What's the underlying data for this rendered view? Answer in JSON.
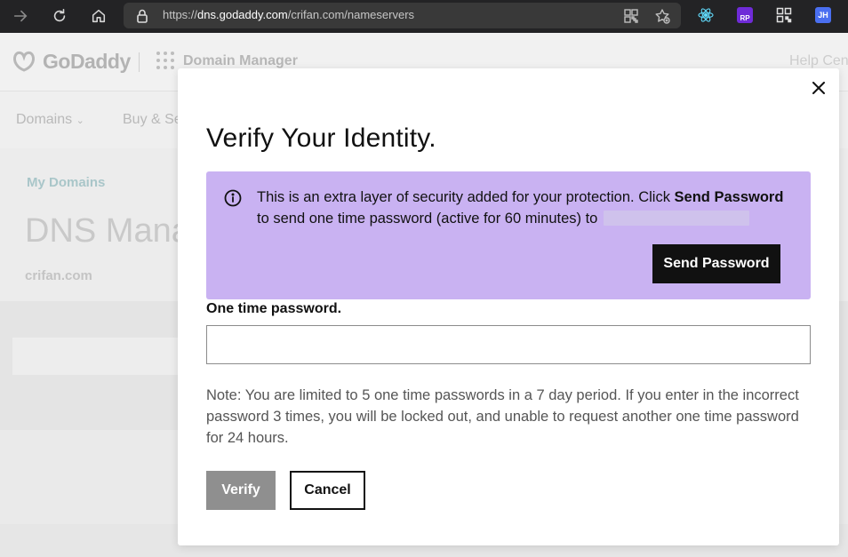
{
  "browser": {
    "url_scheme": "https://",
    "url_host": "dns.godaddy.com",
    "url_path": "/crifan.com/nameservers",
    "icons": [
      "forward-icon",
      "reload-icon",
      "home-icon",
      "lock-icon",
      "qr-code-icon",
      "favorite-icon",
      "react-devtools-icon",
      "extension-rp-icon",
      "qr-extension-icon",
      "profile-icon"
    ],
    "ext_rp_label": "RP",
    "profile_label": "JH"
  },
  "background": {
    "logo_text": "GoDaddy",
    "app_name": "Domain Manager",
    "help_text": "Help Cen",
    "nav": [
      "Domains",
      "Buy & Se"
    ],
    "breadcrumb": "My Domains",
    "page_title": "DNS Mana",
    "domain": "crifan.com"
  },
  "modal": {
    "title": "Verify Your Identity.",
    "alert": {
      "text_before": "This is an extra layer of security added for your protection. Click ",
      "bold": "Send Password",
      "text_after": " to send one time password (active for 60 minutes) to ",
      "button": "Send Password",
      "color": "#c9b2f2"
    },
    "otp_label": "One time password.",
    "otp_value": "",
    "note": "Note: You are limited to 5 one time passwords in a 7 day period. If you enter in the incorrect password 3 times, you will be locked out, and unable to request another one time password for 24 hours.",
    "verify_label": "Verify",
    "cancel_label": "Cancel"
  }
}
